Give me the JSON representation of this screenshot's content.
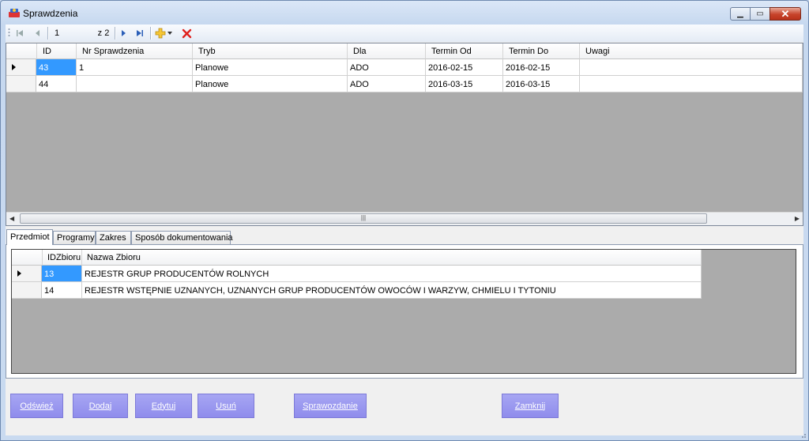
{
  "window": {
    "title": "Sprawdzenia"
  },
  "navigator": {
    "position": "1",
    "count": "z 2"
  },
  "grid1": {
    "columns": [
      "ID",
      "Nr Sprawdzenia",
      "Tryb",
      "Dla",
      "Termin Od",
      "Termin Do",
      "Uwagi"
    ],
    "rows": [
      [
        "43",
        "1",
        "Planowe",
        "ADO",
        "2016-02-15",
        "2016-02-15",
        ""
      ],
      [
        "44",
        "",
        "Planowe",
        "ADO",
        "2016-03-15",
        "2016-03-15",
        ""
      ]
    ]
  },
  "tabs": [
    "Przedmiot",
    "Programy",
    "Zakres",
    "Sposób dokumentowania"
  ],
  "grid2": {
    "columns": [
      "IDZbioru",
      "Nazwa Zbioru"
    ],
    "rows": [
      [
        "13",
        "REJESTR GRUP PRODUCENTÓW ROLNYCH"
      ],
      [
        "14",
        "REJESTR WSTĘPNIE UZNANYCH, UZNANYCH GRUP PRODUCENTÓW OWOCÓW I WARZYW, CHMIELU I TYTONIU"
      ]
    ]
  },
  "buttons": {
    "refresh": "Odśwież",
    "add": "Dodaj",
    "edit": "Edytuj",
    "delete": "Usuń",
    "report": "Sprawozdanie",
    "close": "Zamknij"
  },
  "colors": {
    "button": "#9a98ef",
    "selection": "#3399ff",
    "grid_bg": "#ababab"
  }
}
